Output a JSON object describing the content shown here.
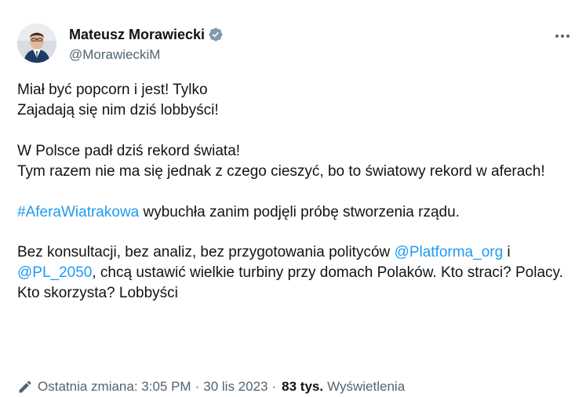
{
  "author": {
    "display_name": "Mateusz Morawiecki",
    "handle": "@MorawieckiM"
  },
  "tweet": {
    "line1": "Miał być popcorn i jest! Tylko",
    "line2": "Zajadają się nim dziś lobbyści!",
    "line3": "W Polsce padł dziś rekord świata!",
    "line4": "Tym razem nie ma się jednak z czego cieszyć, bo to światowy rekord w aferach!",
    "hashtag": "#AferaWiatrakowa",
    "line5_rest": " wybuchła zanim podjęli próbę stworzenia rządu.",
    "line6_start": "Bez konsultacji, bez analiz, bez przygotowania polityców ",
    "mention1": "@Platforma_org",
    "between": " i ",
    "mention2": "@PL_2050",
    "line6_end": ", chcą ustawić wielkie turbiny przy domach Polaków. Kto straci? Polacy. Kto skorzysta? Lobbyści"
  },
  "footer": {
    "edited_label": "Ostatnia zmiana: 3:05 PM",
    "separator": "·",
    "date": "30 lis 2023",
    "views_count": "83 tys.",
    "views_label": "Wyświetlenia"
  },
  "icons": {
    "verified": "verified-badge-icon",
    "more": "more-horizontal-icon",
    "edit": "pencil-icon"
  },
  "colors": {
    "link": "#1d9bf0",
    "secondary_text": "#536471",
    "primary_text": "#0f1419",
    "verified_badge": "#829aab"
  }
}
